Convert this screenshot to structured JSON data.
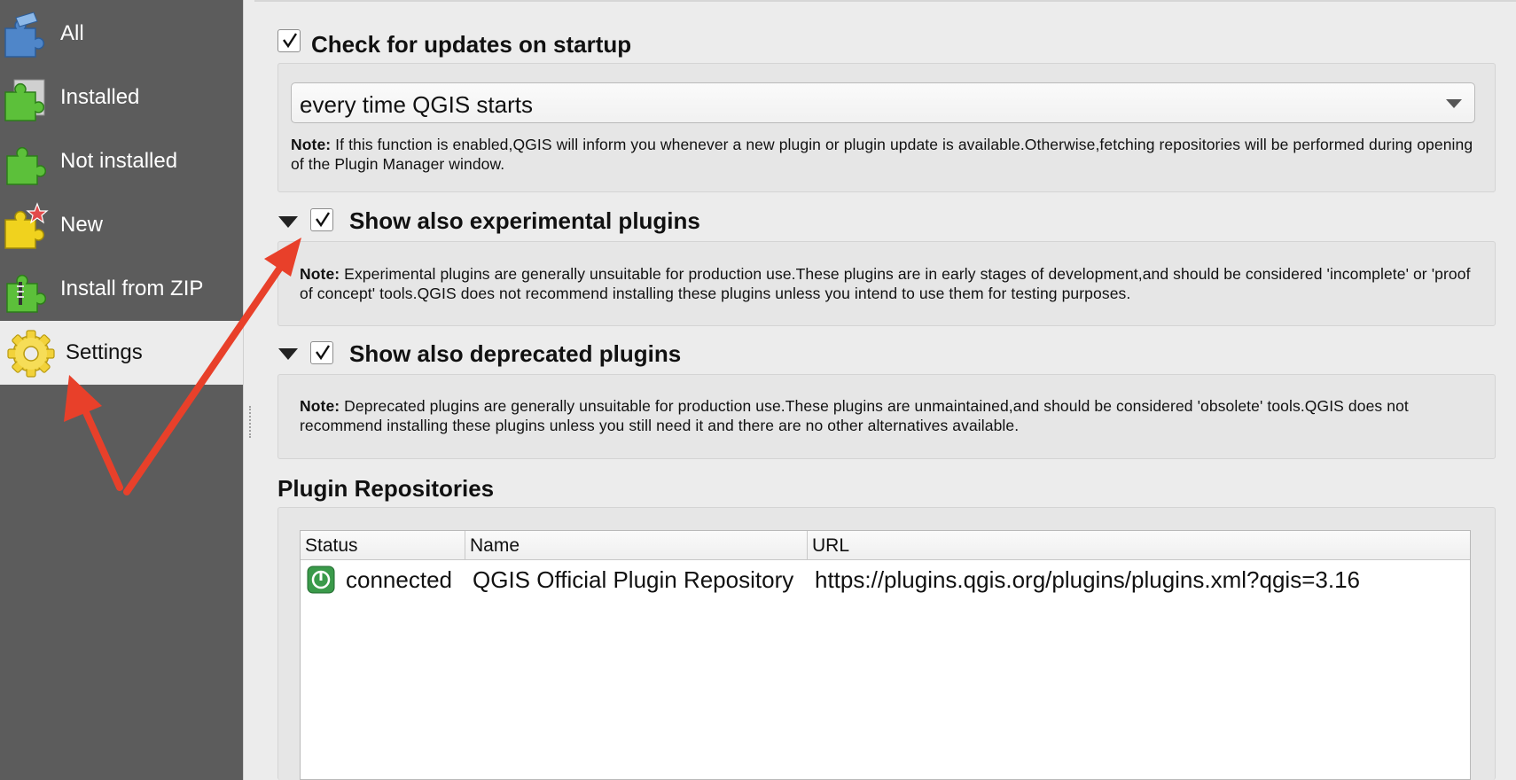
{
  "sidebar": {
    "items": [
      {
        "label": "All",
        "icon": "puzzle-blue-icon"
      },
      {
        "label": "Installed",
        "icon": "puzzle-green-installed-icon"
      },
      {
        "label": "Not installed",
        "icon": "puzzle-green-icon"
      },
      {
        "label": "New",
        "icon": "puzzle-yellow-star-icon"
      },
      {
        "label": "Install from ZIP",
        "icon": "puzzle-zip-icon"
      },
      {
        "label": "Settings",
        "icon": "gear-icon"
      }
    ],
    "active": "Settings"
  },
  "settings": {
    "check_updates": {
      "label": "Check for updates on startup",
      "checked": true,
      "frequency": "every time QGIS starts",
      "note_label": "Note:",
      "note_text": " If this function is enabled,QGIS will inform you whenever a new plugin or plugin update is available.Otherwise,fetching repositories will be performed during opening of the Plugin Manager window."
    },
    "experimental": {
      "label": "Show also experimental plugins",
      "checked": true,
      "note_label": "Note:",
      "note_text": " Experimental plugins are generally unsuitable for production use.These plugins are in early stages of development,and should be considered 'incomplete' or 'proof of concept' tools.QGIS does not recommend installing these plugins unless you intend to use them for testing purposes."
    },
    "deprecated": {
      "label": "Show also deprecated plugins",
      "checked": true,
      "note_label": "Note:",
      "note_text": " Deprecated plugins are generally unsuitable for production use.These plugins are unmaintained,and should be considered 'obsolete' tools.QGIS does not recommend installing these plugins unless you still need it and there are no other alternatives available."
    }
  },
  "repositories": {
    "title": "Plugin Repositories",
    "columns": [
      "Status",
      "Name",
      "URL"
    ],
    "rows": [
      {
        "status": "connected",
        "name": "QGIS Official Plugin Repository",
        "url": "https://plugins.qgis.org/plugins/plugins.xml?qgis=3.16"
      }
    ]
  },
  "colors": {
    "sidebar_bg": "#5c5c5c",
    "annotation_arrow": "#e8402a",
    "status_connected": "#3a9a4a"
  }
}
